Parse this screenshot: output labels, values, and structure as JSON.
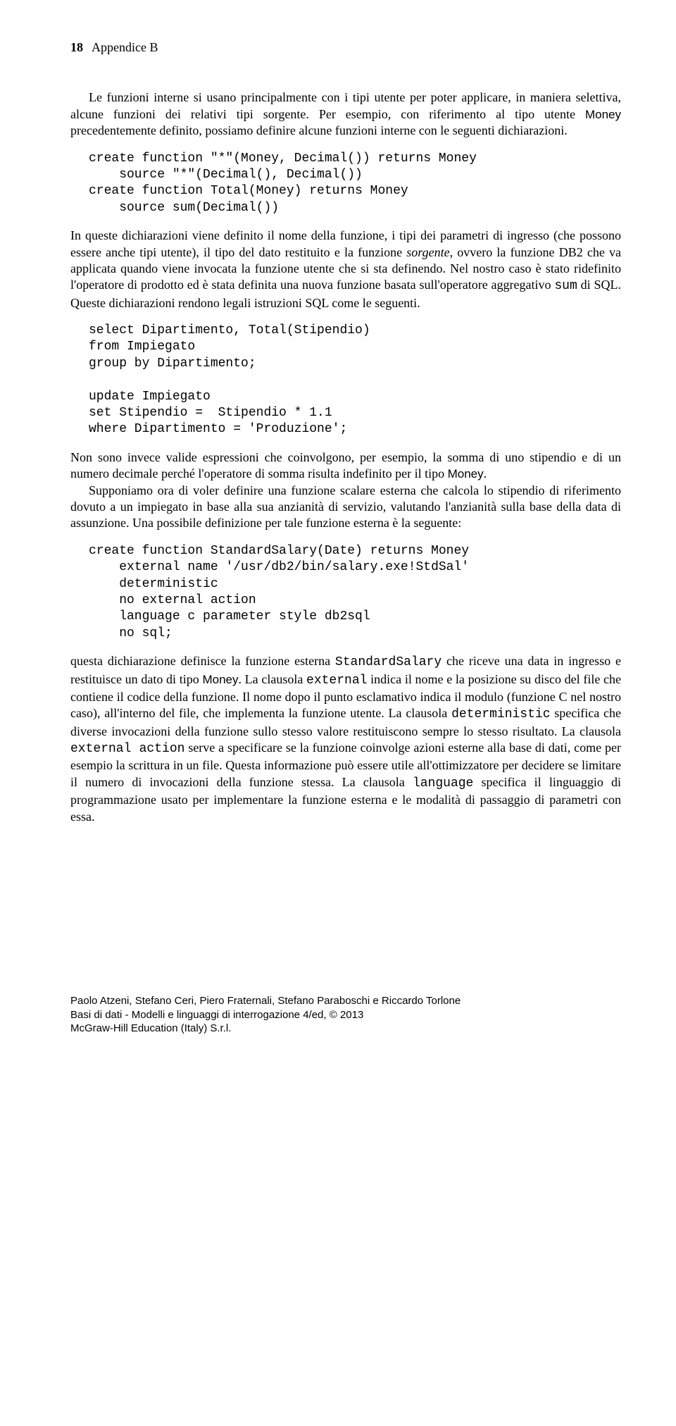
{
  "header": {
    "pagenum": "18",
    "appendix": "Appendice B"
  },
  "para1": "Le funzioni interne si usano principalmente con i tipi utente per poter applicare, in maniera selettiva, alcune funzioni dei relativi tipi sorgente. Per esempio, con riferimento al tipo utente ",
  "para1_sans": "Money",
  "para1_tail": " precedentemente definito, possiamo definire alcune funzioni interne con le seguenti dichiarazioni.",
  "code1": "create function \"*\"(Money, Decimal()) returns Money\n    source \"*\"(Decimal(), Decimal())\ncreate function Total(Money) returns Money\n    source sum(Decimal())",
  "para2_a": "In queste dichiarazioni viene definito il nome della funzione, i tipi dei parametri di ingresso (che possono essere anche tipi utente), il tipo del dato restituito e la funzione ",
  "para2_it": "sorgente",
  "para2_b": ", ovvero la funzione DB2 che va applicata quando viene invocata la funzione utente che si sta definendo. Nel nostro caso è stato ridefinito l'operatore di prodotto ed è stata definita una nuova funzione basata sull'operatore aggregativo ",
  "para2_tt": "sum",
  "para2_c": " di SQL. Queste dichiarazioni rendono legali istruzioni SQL come le seguenti.",
  "code2": "select Dipartimento, Total(Stipendio)\nfrom Impiegato\ngroup by Dipartimento;\n\nupdate Impiegato\nset Stipendio =  Stipendio * 1.1\nwhere Dipartimento = 'Produzione';",
  "para3_a": "Non sono invece valide espressioni che coinvolgono, per esempio, la somma di uno stipendio e di un numero decimale perché l'operatore di somma risulta indefinito per il tipo ",
  "para3_sans": "Money",
  "para3_b": ".",
  "para4": "Supponiamo ora di voler definire una funzione scalare esterna che calcola lo stipendio di riferimento dovuto a un impiegato in base alla sua anzianità di servizio, valutando l'anzianità sulla base della data di assunzione. Una possibile definizione per tale funzione esterna è la seguente:",
  "code3": "create function StandardSalary(Date) returns Money\n    external name '/usr/db2/bin/salary.exe!StdSal'\n    deterministic\n    no external action\n    language c parameter style db2sql\n    no sql;",
  "para5_a": "questa dichiarazione definisce la funzione esterna ",
  "para5_tt1": "StandardSalary",
  "para5_b": " che riceve una data in ingresso e restituisce un dato di tipo ",
  "para5_sans": "Money",
  "para5_c": ". La clausola ",
  "para5_tt2": "external",
  "para5_d": " indica il nome e la posizione su disco del file che contiene il codice della funzione. Il nome dopo il punto esclamativo indica il modulo (funzione C nel nostro caso), all'interno del file, che implementa la funzione utente. La clausola ",
  "para5_tt3": "deterministic",
  "para5_e": " specifica che diverse invocazioni della funzione sullo stesso valore restituiscono sempre lo stesso risultato. La clausola ",
  "para5_tt4": "external action",
  "para5_f": " serve a specificare se la funzione coinvolge azioni esterne alla base di dati, come per esempio la scrittura in un file. Questa informazione può essere utile all'ottimizzatore per decidere se limitare il numero di invocazioni della funzione stessa. La clausola ",
  "para5_tt5": "language",
  "para5_g": " specifica il linguaggio di programmazione usato per implementare la funzione esterna e le modalità di passaggio di parametri con essa.",
  "footer": {
    "line1": "Paolo Atzeni, Stefano Ceri, Piero Fraternali, Stefano Paraboschi e Riccardo Torlone",
    "line2": "Basi di dati - Modelli e linguaggi di interrogazione 4/ed, © 2013",
    "line3": "McGraw-Hill Education (Italy) S.r.l."
  }
}
